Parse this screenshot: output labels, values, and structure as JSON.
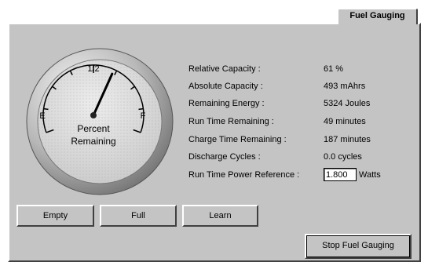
{
  "tab": {
    "label": "Fuel Gauging"
  },
  "gauge": {
    "half_label": "1/2",
    "empty_label": "E",
    "full_label": "F",
    "center_label_line1": "Percent",
    "center_label_line2": "Remaining",
    "level_fraction": 0.61
  },
  "fields": [
    {
      "label": "Relative Capacity :",
      "value": "61 %"
    },
    {
      "label": "Absolute Capacity :",
      "value": "493 mAhrs"
    },
    {
      "label": "Remaining Energy :",
      "value": "5324 Joules"
    },
    {
      "label": "Run Time Remaining :",
      "value": "49 minutes"
    },
    {
      "label": "Charge Time Remaining :",
      "value": "187 minutes"
    },
    {
      "label": "Discharge Cycles :",
      "value": "0.0 cycles"
    }
  ],
  "power_reference": {
    "label": "Run Time Power Reference :",
    "value": "1.800",
    "unit": "Watts"
  },
  "buttons": {
    "empty": "Empty",
    "full": "Full",
    "learn": "Learn",
    "stop": "Stop Fuel Gauging"
  },
  "colors": {
    "panel": "#c4c4c4",
    "gauge_face": "#d8d8d8",
    "needle": "#000000"
  }
}
